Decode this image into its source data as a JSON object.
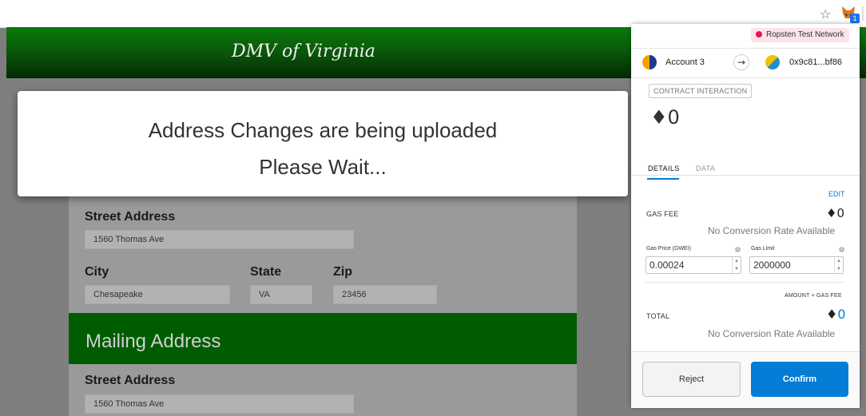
{
  "browser": {
    "star_icon": "star-icon",
    "extension_icon": "metamask-fox-icon",
    "extension_badge": "1"
  },
  "page": {
    "header_title": "DMV of Virginia",
    "residential": {
      "street_label": "Street Address",
      "street_value": "1560 Thomas Ave",
      "city_label": "City",
      "city_value": "Chesapeake",
      "state_label": "State",
      "state_value": "VA",
      "zip_label": "Zip",
      "zip_value": "23456"
    },
    "mailing": {
      "title": "Mailing Address",
      "street_label": "Street Address",
      "street_value": "1560 Thomas Ave"
    }
  },
  "modal": {
    "line1": "Address Changes are being uploaded",
    "line2": "Please Wait..."
  },
  "metamask": {
    "network": "Ropsten Test Network",
    "account_name": "Account 3",
    "to_address": "0x9c81...bf86",
    "interaction_label": "CONTRACT INTERACTION",
    "amount": "0",
    "tabs": {
      "details": "DETAILS",
      "data": "DATA"
    },
    "edit": "EDIT",
    "gas_fee_label": "GAS FEE",
    "gas_fee_value": "0",
    "no_conversion": "No Conversion Rate Available",
    "gas_price_label": "Gas Price (GWEI)",
    "gas_price_value": "0.00024",
    "gas_limit_label": "Gas Limit",
    "gas_limit_value": "2000000",
    "amount_gas_label": "AMOUNT + GAS FEE",
    "total_label": "TOTAL",
    "total_value": "0",
    "reject": "Reject",
    "confirm": "Confirm"
  },
  "colors": {
    "header_green": "#0a7a0a",
    "mailing_green": "#005c00",
    "metamask_blue": "#037dd6",
    "network_dot": "#e91550"
  }
}
